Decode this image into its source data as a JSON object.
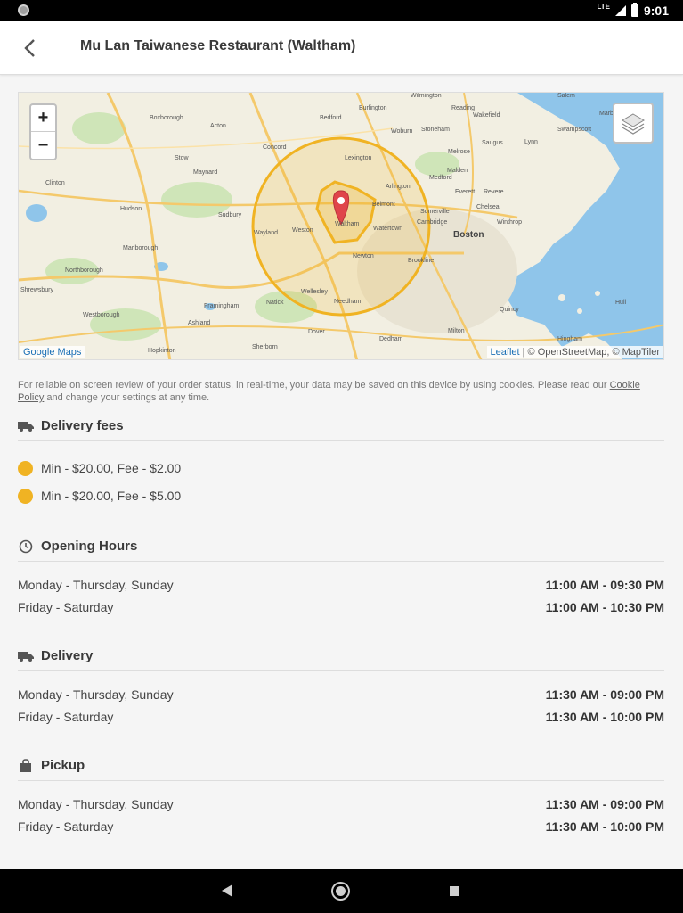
{
  "status_bar": {
    "network": "LTE",
    "time": "9:01"
  },
  "header": {
    "title": "Mu Lan Taiwanese Restaurant (Waltham)"
  },
  "map": {
    "zoom_in": "+",
    "zoom_out": "−",
    "attribution_left": "Google Maps",
    "attribution_leaflet": "Leaflet",
    "attribution_rest": " | © OpenStreetMap, © MapTiler",
    "places": {
      "boston": "Boston",
      "lexington": "Lexington",
      "burlington": "Burlington",
      "woburn": "Woburn",
      "bedford": "Bedford",
      "concord": "Concord",
      "acton": "Acton",
      "boxborough": "Boxborough",
      "maynard": "Maynard",
      "sudbury": "Sudbury",
      "hudson": "Hudson",
      "marlborough": "Marlborough",
      "northborough": "Northborough",
      "shrewsbury": "Shrewsbury",
      "westborough": "Westborough",
      "framingham": "Framingham",
      "natick": "Natick",
      "wellesley": "Wellesley",
      "needham": "Needham",
      "newton": "Newton",
      "waltham": "Waltham",
      "weston": "Weston",
      "wayland": "Wayland",
      "watertown": "Watertown",
      "belmont": "Belmont",
      "arlington": "Arlington",
      "somerville": "Somerville",
      "cambridge": "Cambridge",
      "medford": "Medford",
      "melrose": "Melrose",
      "malden": "Malden",
      "everett": "Everett",
      "revere": "Revere",
      "chelsea": "Chelsea",
      "winthrop": "Winthrop",
      "lynn": "Lynn",
      "saugus": "Saugus",
      "salem": "Salem",
      "marblehead": "Marblehead",
      "swampscott": "Swampscott",
      "stoneham": "Stoneham",
      "wilmington": "Wilmington",
      "reading": "Reading",
      "wakefield": "Wakefield",
      "brookline": "Brookline",
      "milton": "Milton",
      "dedham": "Dedham",
      "quincy": "Quincy",
      "hingham": "Hingham",
      "hull": "Hull",
      "hopkinton": "Hopkinton",
      "ashland": "Ashland",
      "clinton": "Clinton",
      "stow": "Stow",
      "dover": "Dover",
      "sherborn": "Sherborn"
    }
  },
  "cookie": {
    "text_before": "For reliable on screen review of your order status, in real-time, your data may be saved on this device by using cookies. Please read our ",
    "link": "Cookie Policy",
    "text_after": " and change your settings at any time."
  },
  "delivery_fees": {
    "title": "Delivery fees",
    "items": [
      {
        "label": "Min - $20.00, Fee - $2.00",
        "color": "#f0b323"
      },
      {
        "label": "Min - $20.00, Fee - $5.00",
        "color": "#f0b323"
      }
    ]
  },
  "opening_hours": {
    "title": "Opening Hours",
    "rows": [
      {
        "day": "Monday - Thursday, Sunday",
        "time": "11:00 AM - 09:30 PM"
      },
      {
        "day": "Friday - Saturday",
        "time": "11:00 AM - 10:30 PM"
      }
    ]
  },
  "delivery": {
    "title": "Delivery",
    "rows": [
      {
        "day": "Monday - Thursday, Sunday",
        "time": "11:30 AM - 09:00 PM"
      },
      {
        "day": "Friday - Saturday",
        "time": "11:30 AM - 10:00 PM"
      }
    ]
  },
  "pickup": {
    "title": "Pickup",
    "rows": [
      {
        "day": "Monday - Thursday, Sunday",
        "time": "11:30 AM - 09:00 PM"
      },
      {
        "day": "Friday - Saturday",
        "time": "11:30 AM - 10:00 PM"
      }
    ]
  },
  "colors": {
    "accent": "#f0b323",
    "marker": "#e0454a",
    "water": "#8fc5ea"
  }
}
